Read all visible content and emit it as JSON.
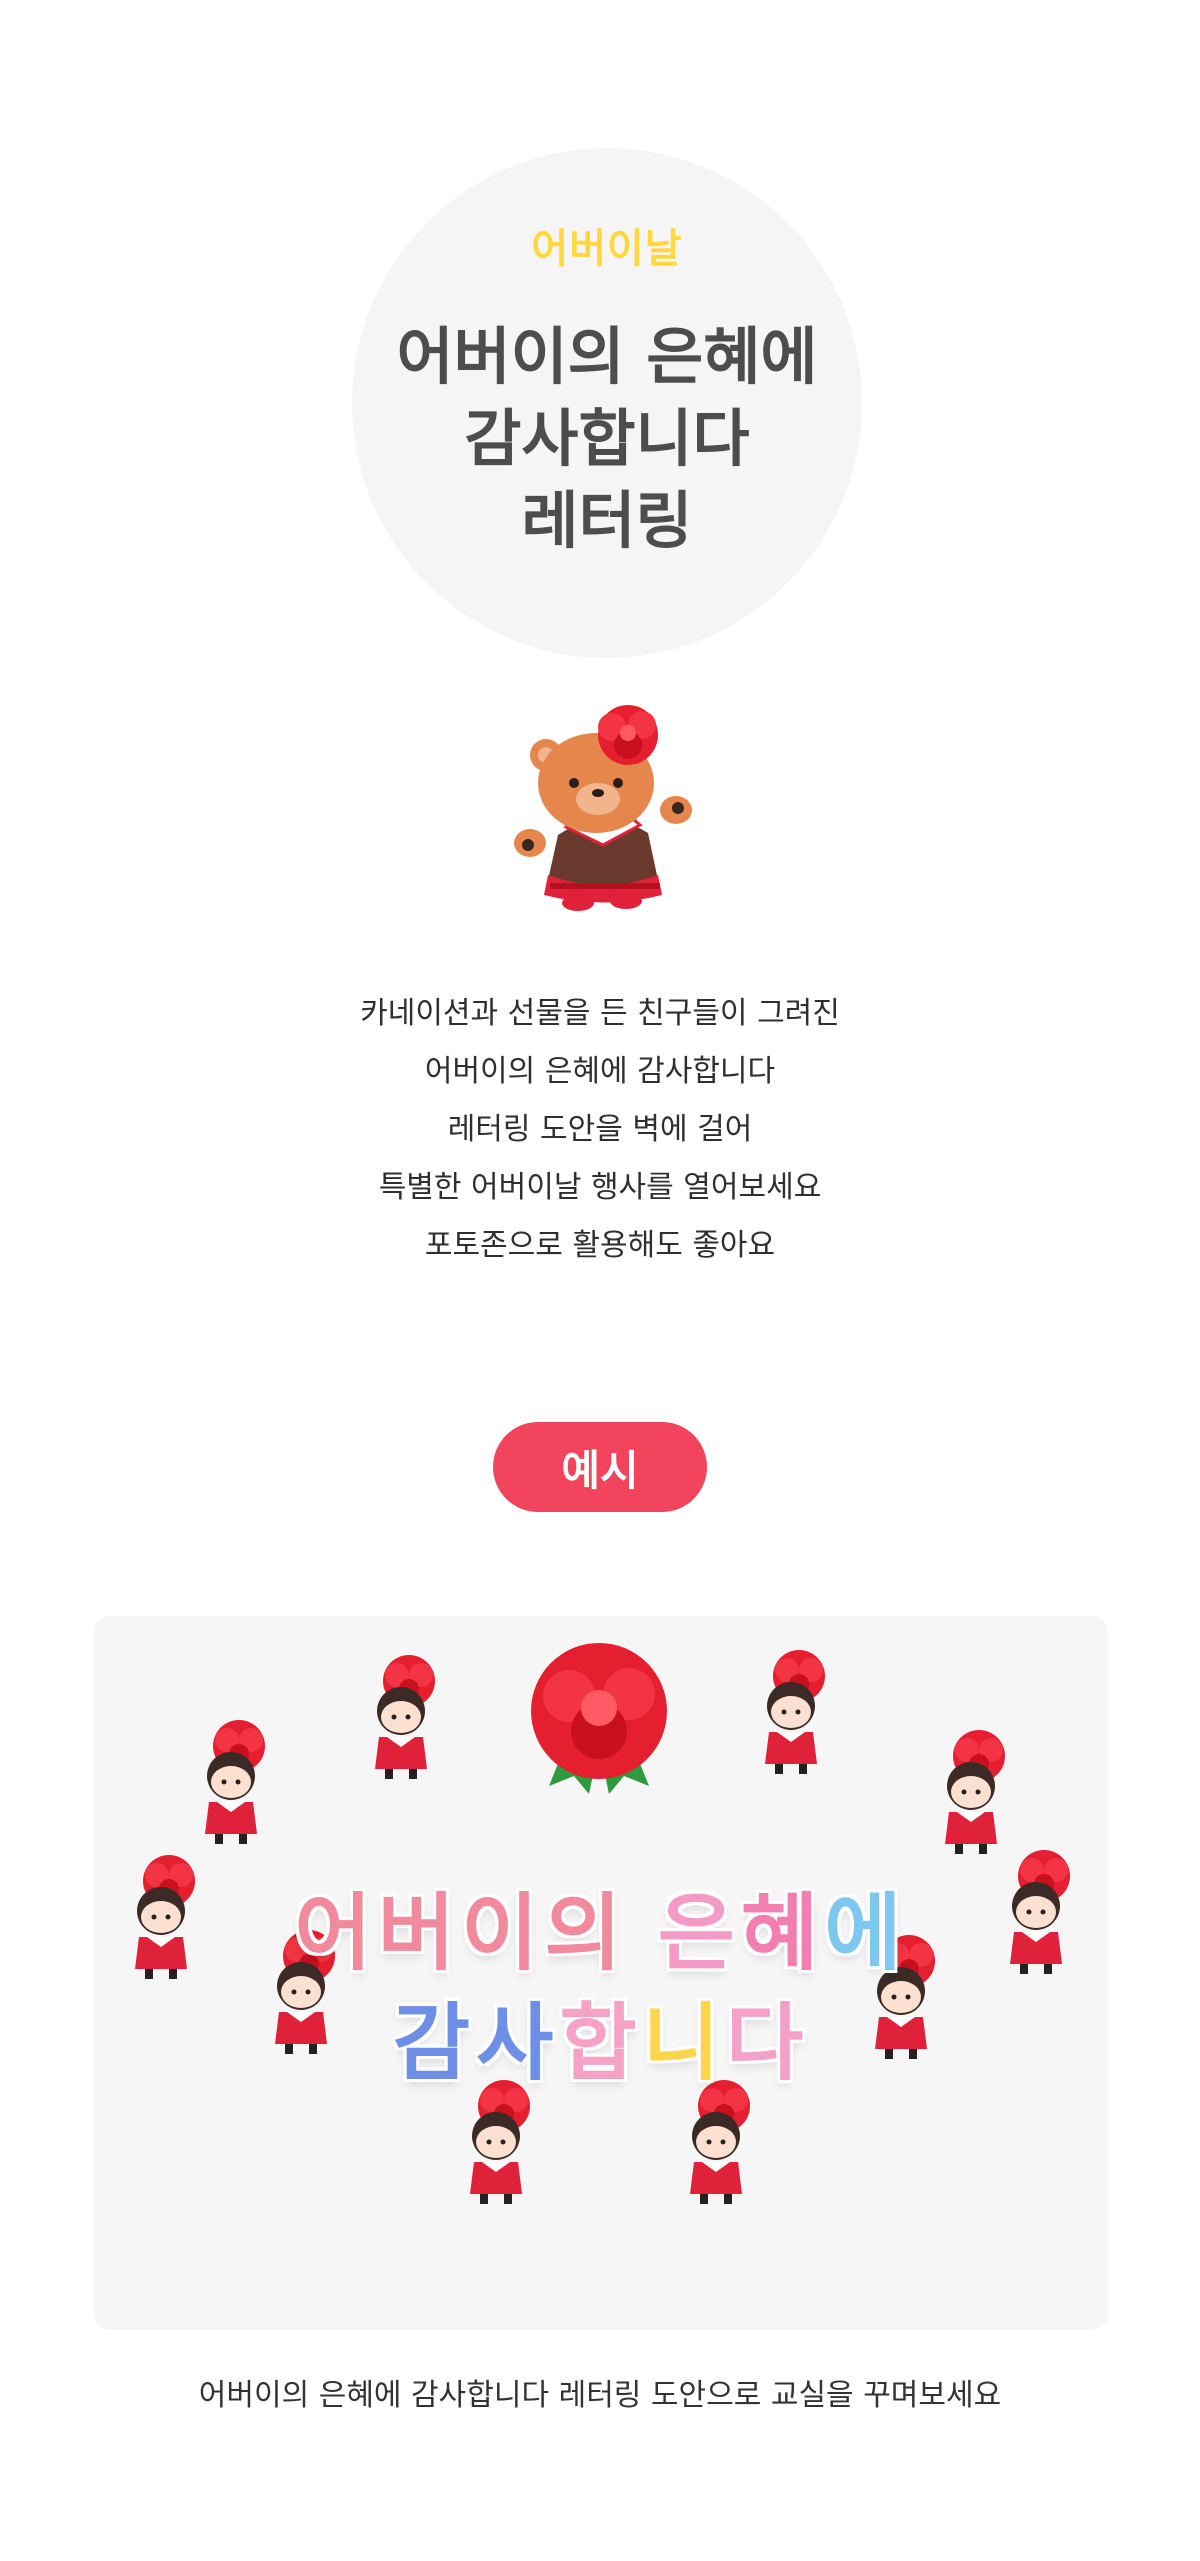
{
  "hero": {
    "subtitle": "어버이날",
    "title_lines": [
      "어버이의 은혜에",
      "감사합니다",
      "레터링"
    ],
    "subtitle_color": "#ffd83c"
  },
  "mascot": {
    "icon": "bear-with-carnation-icon"
  },
  "description": {
    "lines": [
      "카네이션과 선물을 든 친구들이 그려진",
      "어버이의 은혜에 감사합니다",
      "레터링 도안을 벽에 걸어",
      "특별한 어버이날 행사를 열어보세요",
      "포토존으로 활용해도 좋아요"
    ]
  },
  "example": {
    "badge_label": "예시",
    "badge_color": "#f2445c",
    "lettering": {
      "line1": [
        "어",
        "버",
        "이",
        "의",
        " ",
        "은",
        "혜",
        "에"
      ],
      "line2": [
        "감",
        "사",
        "합",
        "니",
        "다"
      ],
      "line1_colors": [
        "#f08a9c",
        "#f08a9c",
        "#f08a9c",
        "#f08a9c",
        "#ffffff",
        "#f39ac6",
        "#f27fb0",
        "#7ec8ef"
      ],
      "line2_colors": [
        "#6e8fe6",
        "#6e8fe6",
        "#f6a2c6",
        "#ffd54a",
        "#f4a0c8"
      ]
    },
    "caption": "어버이의 은혜에 감사합니다 레터링 도안으로 교실을 꾸며보세요"
  }
}
